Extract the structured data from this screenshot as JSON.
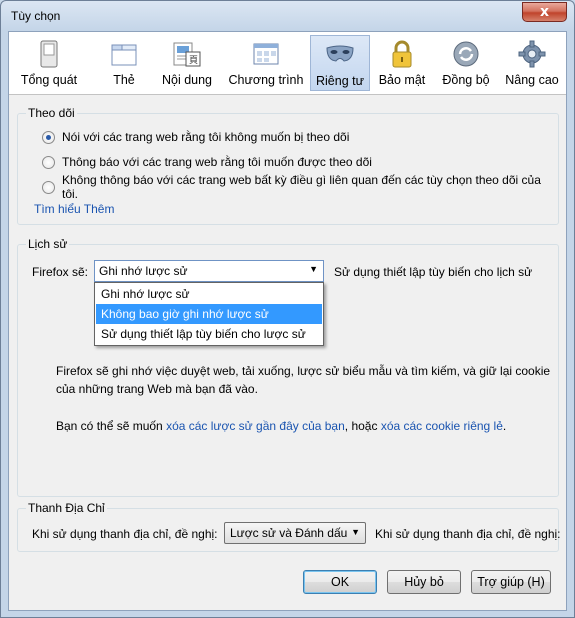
{
  "window": {
    "title": "Tùy chọn",
    "close_glyph": "x"
  },
  "tabs": [
    {
      "label": "Tổng quát",
      "icon": "switch-icon"
    },
    {
      "label": "Thẻ",
      "icon": "tabs-icon"
    },
    {
      "label": "Nội dung",
      "icon": "content-icon"
    },
    {
      "label": "Chương trình",
      "icon": "applications-icon"
    },
    {
      "label": "Riêng tư",
      "icon": "privacy-mask-icon",
      "active": true
    },
    {
      "label": "Bảo mật",
      "icon": "padlock-icon"
    },
    {
      "label": "Đồng bộ",
      "icon": "sync-icon"
    },
    {
      "label": "Nâng cao",
      "icon": "gear-icon"
    }
  ],
  "tracking": {
    "title": "Theo dõi",
    "options": [
      {
        "label": "Nói với các trang web rằng tôi không muốn bị theo dõi",
        "checked": true
      },
      {
        "label": "Thông báo với các trang web rằng tôi muốn được theo dõi",
        "checked": false
      },
      {
        "label": "Không thông báo với các trang web bất kỳ điều gì liên quan đến các tùy chọn theo dõi của tôi.",
        "checked": false
      }
    ],
    "learn_more": "Tìm hiểu Thêm"
  },
  "history": {
    "title": "Lịch sử",
    "firefox_will": "Firefox sẽ:",
    "selected": "Ghi nhớ lược sử",
    "side_note": "Sử dụng thiết lập tùy biến cho lịch sử",
    "options": [
      "Ghi nhớ lược sử",
      "Không bao giờ ghi nhớ lược sử",
      "Sử dụng thiết lập tùy biến cho lược sử"
    ],
    "highlighted_index": 1,
    "description_line1": "Firefox sẽ ghi nhớ việc duyệt web, tải xuống, lược sử biểu mẫu và tìm kiếm, và giữ lại cookie",
    "description_line2": "của những trang Web mà bạn đã vào.",
    "clear_prefix": "Bạn có thể sẽ muốn",
    "clear_link": "xóa các lược sử gần đây của bạn",
    "clear_middle": ", hoặc",
    "cookies_link": "xóa các cookie riêng lẻ",
    "clear_suffix": "."
  },
  "location_bar": {
    "title": "Thanh Địa Chỉ",
    "label": "Khi sử dụng thanh địa chỉ, đề nghị:",
    "selected": "Lược sử và Đánh dấu",
    "trailing_label": "Khi sử dụng thanh địa chỉ, đề nghị:"
  },
  "buttons": {
    "ok": "OK",
    "cancel": "Hủy bỏ",
    "help": "Trợ giúp (H)"
  },
  "colors": {
    "accent": "#3399ff",
    "link": "#1a54b0"
  }
}
